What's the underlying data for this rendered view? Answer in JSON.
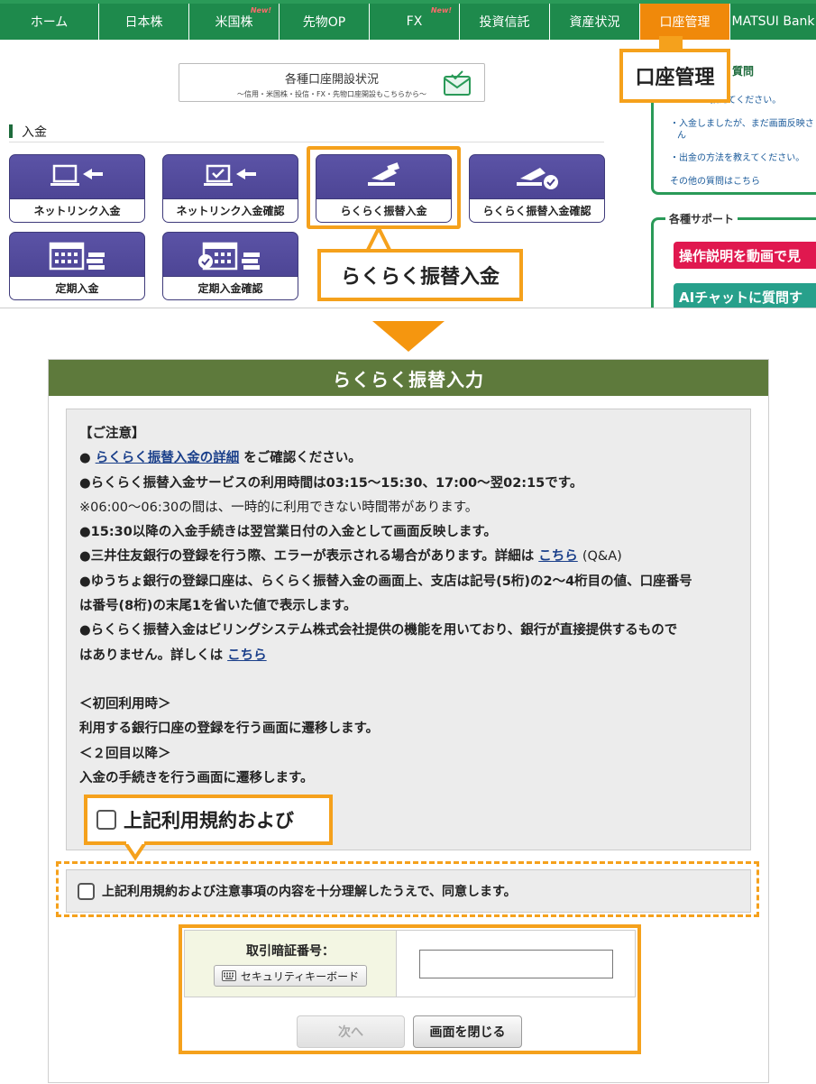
{
  "nav": {
    "items": [
      "ホーム",
      "日本株",
      "米国株",
      "先物OP",
      "FX",
      "投資信託",
      "資産状況",
      "口座管理",
      "MATSUI Bank"
    ],
    "new_badge": "New!",
    "active": "口座管理"
  },
  "banner": {
    "title": "各種口座開設状況",
    "subtitle": "〜信用・米国株・投信・FX・先物口座開設もこちらから〜"
  },
  "section_title": "入金",
  "tiles": [
    {
      "label": "ネットリンク入金",
      "icon": "laptop-arrow-icon"
    },
    {
      "label": "ネットリンク入金確認",
      "icon": "laptop-check-icon"
    },
    {
      "label": "らくらく振替入金",
      "icon": "hand-card-icon"
    },
    {
      "label": "らくらく振替入金確認",
      "icon": "hand-card-check-icon"
    },
    {
      "label": "定期入金",
      "icon": "calendar-money-icon"
    },
    {
      "label": "定期入金確認",
      "icon": "calendar-check-money-icon"
    }
  ],
  "faq": {
    "title": "質問",
    "links": [
      "教えてください。",
      "・入金しましたが、まだ画面反映さ",
      "ん",
      "・出金の方法を教えてください。",
      "その他の質問はこちら"
    ]
  },
  "support": {
    "title": "各種サポート",
    "video_btn": "操作説明を動画で見",
    "ai_btn": "AIチャットに質問す",
    "colors": {
      "video": "#e0184f",
      "ai": "#27a08b"
    }
  },
  "callouts": {
    "account_menu": "口座管理",
    "furikae": "らくらく振替入金",
    "terms": "上記利用規約および"
  },
  "dialog": {
    "title": "らくらく振替入力",
    "notice": {
      "heading": "【ご注意】",
      "line1_link": "らくらく振替入金の詳細",
      "line1_rest": "をご確認ください。",
      "line2": "●らくらく振替入金サービスの利用時間は03:15〜15:30、17:00〜翌02:15です。",
      "line3": "※06:00〜06:30の間は、一時的に利用できない時間帯があります。",
      "line4": "●15:30以降の入金手続きは翌営業日付の入金として画面反映します。",
      "line5_pre": "●三井住友銀行の登録を行う際、エラーが表示される場合があります。詳細は",
      "line5_link": "こちら",
      "line5_post": "(Q&A)",
      "line6a": "●ゆうちょ銀行の登録口座は、らくらく振替入金の画面上、支店は記号(5桁)の2〜4桁目の値、口座番号",
      "line6b": "は番号(8桁)の末尾1を省いた値で表示します。",
      "line7a": "●らくらく振替入金はビリングシステム株式会社提供の機能を用いており、銀行が直接提供するもので",
      "line7b_pre": "はありません。詳しくは",
      "line7b_link": "こちら",
      "first_use_h": "＜初回利用時＞",
      "first_use": "利用する銀行口座の登録を行う画面に遷移します。",
      "second_h": "＜２回目以降＞",
      "second": "入金の手続きを行う画面に遷移します。"
    },
    "agree_label": "上記利用規約および注意事項の内容を十分理解したうえで、同意します。",
    "pin_label": "取引暗証番号：",
    "keyboard_btn": "セキュリティキーボード",
    "next_btn": "次へ",
    "close_btn": "画面を閉じる",
    "pin_value": ""
  }
}
